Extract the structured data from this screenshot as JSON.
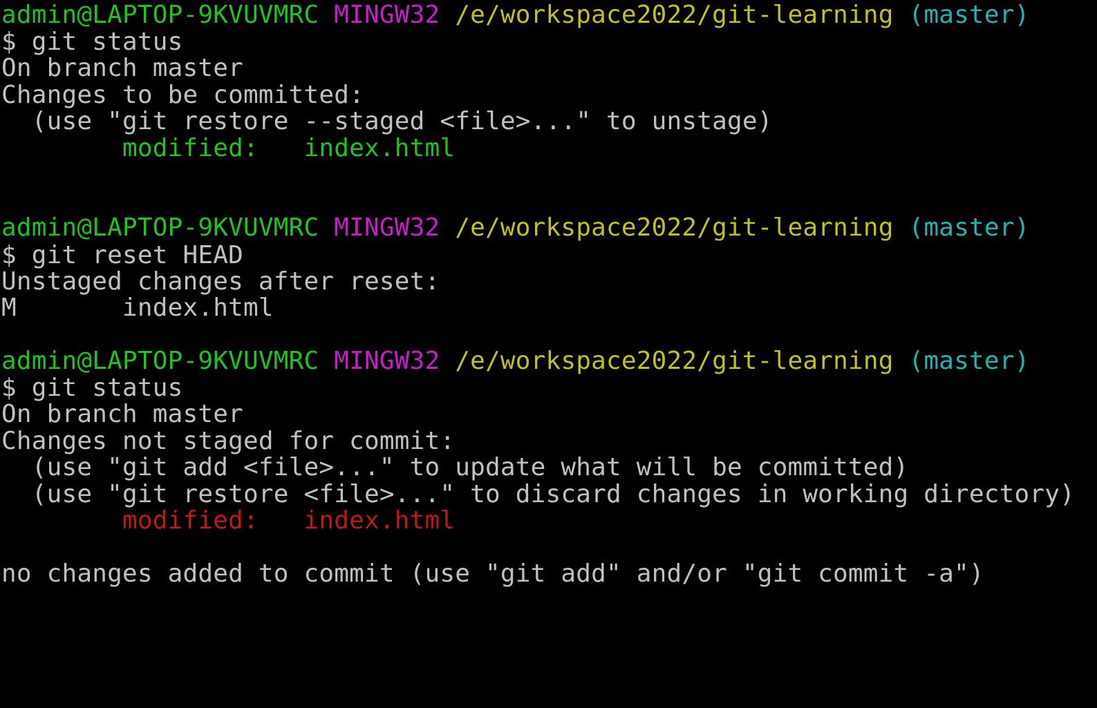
{
  "colors": {
    "background": "#000000",
    "text": "#c0c0c0",
    "user_host": "#1ec51e",
    "environment": "#c81ec8",
    "path": "#c0c01e",
    "branch": "#1eb4b4",
    "staged": "#1ec51e",
    "unstaged": "#c01818"
  },
  "prompt": {
    "user_host": "admin@LAPTOP-9KVUVMRC",
    "environment": "MINGW32",
    "path": "/e/workspace2022/git-learning",
    "branch": "(master)"
  },
  "block1": {
    "command": "$ git status",
    "branch_line": "On branch master",
    "header": "Changes to be committed:",
    "hint": "  (use \"git restore --staged <file>...\" to unstage)",
    "status_label": "        modified:",
    "file": "   index.html"
  },
  "block2": {
    "command": "$ git reset HEAD",
    "header": "Unstaged changes after reset:",
    "status_code": "M",
    "file": "       index.html"
  },
  "block3": {
    "command": "$ git status",
    "branch_line": "On branch master",
    "header": "Changes not staged for commit:",
    "hint1": "  (use \"git add <file>...\" to update what will be committed)",
    "hint2": "  (use \"git restore <file>...\" to discard changes in working directory)",
    "status_label": "        modified:",
    "file": "   index.html",
    "footer": "no changes added to commit (use \"git add\" and/or \"git commit -a\")"
  }
}
